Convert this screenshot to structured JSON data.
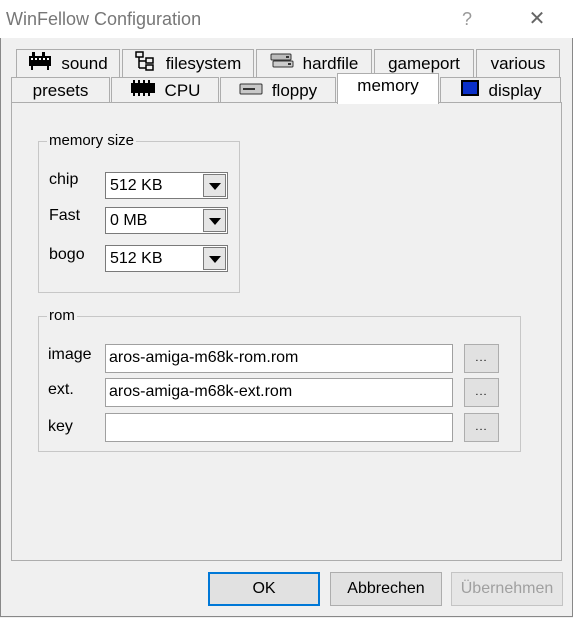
{
  "window": {
    "title": "WinFellow Configuration",
    "help_glyph": "?",
    "close_glyph": "✕"
  },
  "tabs_back": [
    {
      "label": "sound",
      "icon": "sound-icon"
    },
    {
      "label": "filesystem",
      "icon": "filesystem-icon"
    },
    {
      "label": "hardfile",
      "icon": "hardfile-icon"
    },
    {
      "label": "gameport",
      "icon": ""
    },
    {
      "label": "various",
      "icon": ""
    }
  ],
  "tabs_front": [
    {
      "label": "presets",
      "icon": ""
    },
    {
      "label": "CPU",
      "icon": "cpu-chip-icon"
    },
    {
      "label": "floppy",
      "icon": "floppy-icon"
    },
    {
      "label": "memory",
      "icon": "",
      "active": true
    },
    {
      "label": "display",
      "icon": "display-icon"
    }
  ],
  "memory_size": {
    "legend": "memory size",
    "chip": {
      "label": "chip",
      "value": "512 KB"
    },
    "fast": {
      "label": "Fast",
      "value": "0 MB"
    },
    "bogo": {
      "label": "bogo",
      "value": "512 KB"
    }
  },
  "rom": {
    "legend": "rom",
    "image": {
      "label": "image",
      "value": "aros-amiga-m68k-rom.rom",
      "browse": "..."
    },
    "ext": {
      "label": "ext.",
      "value": "aros-amiga-m68k-ext.rom",
      "browse": "..."
    },
    "key": {
      "label": "key",
      "value": "",
      "browse": "..."
    }
  },
  "buttons": {
    "ok": "OK",
    "cancel": "Abbrechen",
    "apply": "Übernehmen"
  },
  "colors": {
    "default_button_border": "#0078d7",
    "display_icon": "#0a2fc8"
  }
}
